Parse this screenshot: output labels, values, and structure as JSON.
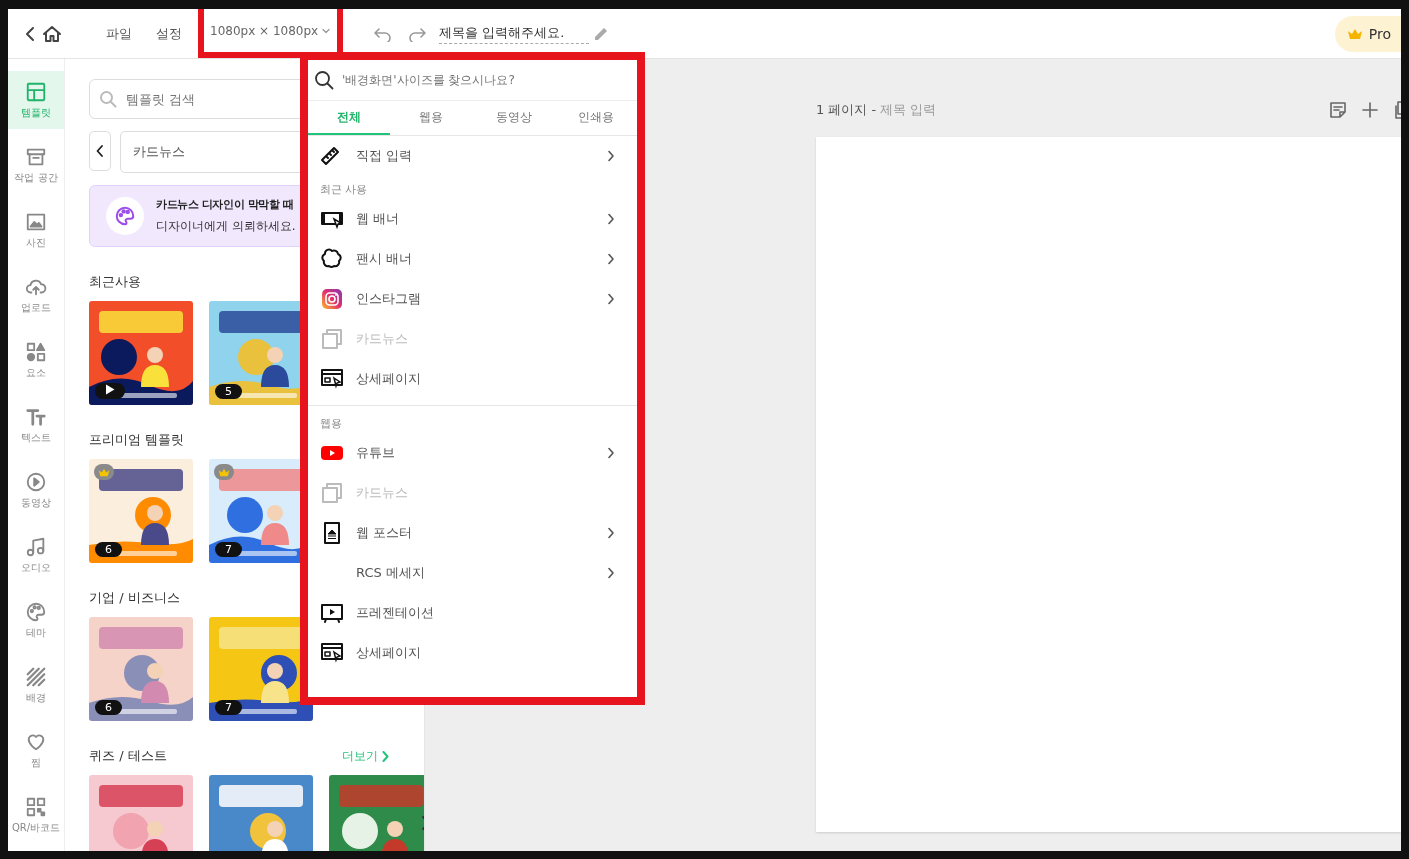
{
  "topbar": {
    "file_menu": "파일",
    "settings_menu": "설정",
    "size": "1080px × 1080px",
    "title": "제목을 입력해주세요.",
    "pro_button": "Pro",
    "undo_disabled": false,
    "redo_disabled": false
  },
  "rail": [
    {
      "label": "템플릿",
      "selected": true
    },
    {
      "label": "작업 공간",
      "selected": false
    },
    {
      "label": "사진",
      "selected": false
    },
    {
      "label": "업로드",
      "selected": false
    },
    {
      "label": "요소",
      "selected": false
    },
    {
      "label": "텍스트",
      "selected": false
    },
    {
      "label": "동영상",
      "selected": false
    },
    {
      "label": "오디오",
      "selected": false
    },
    {
      "label": "테마",
      "selected": false
    },
    {
      "label": "배경",
      "selected": false
    },
    {
      "label": "찜",
      "selected": false
    },
    {
      "label": "QR/바코드",
      "selected": false
    }
  ],
  "panel": {
    "search": {
      "placeholder": "템플릿 검색"
    },
    "category": "카드뉴스",
    "promo": {
      "title": "카드뉴스 디자인이 막막할 때",
      "subtitle": "디자이너에게 의뢰하세요."
    },
    "sections": [
      {
        "title": "최근사용",
        "cards": [
          {
            "kind": "picture",
            "video": true
          },
          {
            "kind": "picture",
            "badge": "5"
          }
        ]
      },
      {
        "title": "프리미엄 템플릿",
        "cards": [
          {
            "kind": "picture",
            "badge": "6",
            "premium": true
          },
          {
            "kind": "picture",
            "badge": "7",
            "premium": true
          }
        ]
      },
      {
        "title": "기업 / 비즈니스",
        "cards": [
          {
            "kind": "picture",
            "badge": "6"
          },
          {
            "kind": "picture",
            "badge": "7"
          }
        ]
      },
      {
        "title": "퀴즈 / 테스트",
        "more": "더보기",
        "cards": [
          {
            "kind": "picture"
          },
          {
            "kind": "picture"
          },
          {
            "kind": "picture"
          }
        ]
      }
    ]
  },
  "canvas": {
    "page_label": "1 페이지 -",
    "page_title": "제목 입력"
  },
  "size_menu": {
    "search": {
      "placeholder": "'배경화면'사이즈를 찾으시나요?"
    },
    "tabs": [
      {
        "label": "전체",
        "selected": true
      },
      {
        "label": "웹용",
        "selected": false
      },
      {
        "label": "동영상",
        "selected": false
      },
      {
        "label": "인쇄용",
        "selected": false
      }
    ],
    "rows": [
      {
        "kind": "option",
        "label": "직접 입력",
        "submenu": true,
        "disabled": false
      },
      {
        "kind": "header",
        "label": "최근 사용"
      },
      {
        "kind": "option",
        "label": "웹 배너",
        "submenu": true,
        "disabled": false
      },
      {
        "kind": "option",
        "label": "팬시 배너",
        "submenu": true,
        "disabled": false
      },
      {
        "kind": "option",
        "label": "인스타그램",
        "submenu": true,
        "disabled": false
      },
      {
        "kind": "option",
        "label": "카드뉴스",
        "submenu": false,
        "disabled": true
      },
      {
        "kind": "option",
        "label": "상세페이지",
        "submenu": false,
        "disabled": false
      },
      {
        "kind": "divider"
      },
      {
        "kind": "header",
        "label": "웹용"
      },
      {
        "kind": "option",
        "label": "유튜브",
        "submenu": true,
        "disabled": false
      },
      {
        "kind": "option",
        "label": "카드뉴스",
        "submenu": false,
        "disabled": true
      },
      {
        "kind": "option",
        "label": "웹 포스터",
        "submenu": true,
        "disabled": false
      },
      {
        "kind": "option",
        "label": "RCS 메세지",
        "submenu": true,
        "disabled": false
      },
      {
        "kind": "option",
        "label": "프레젠테이션",
        "submenu": false,
        "disabled": false
      },
      {
        "kind": "option",
        "label": "상세페이지",
        "submenu": false,
        "disabled": false
      }
    ]
  }
}
